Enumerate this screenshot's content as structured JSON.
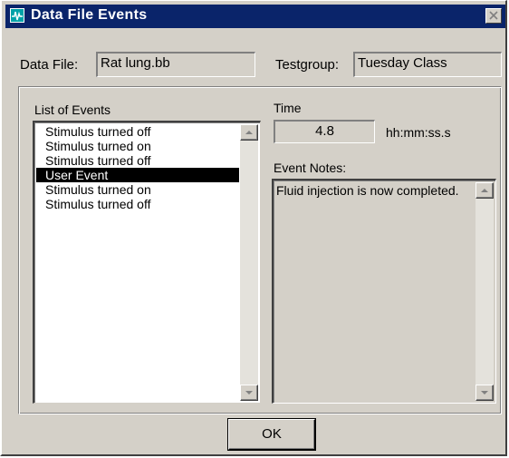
{
  "window": {
    "title": "Data File Events",
    "icon": "waveform-icon",
    "close_icon": "close-icon"
  },
  "header": {
    "data_file_label": "Data File:",
    "data_file_value": "Rat lung.bb",
    "testgroup_label": "Testgroup:",
    "testgroup_value": "Tuesday Class"
  },
  "events": {
    "label": "List of Events",
    "items": [
      "Stimulus turned off",
      "Stimulus turned on",
      "Stimulus turned off",
      "User Event",
      "Stimulus turned on",
      "Stimulus turned off"
    ],
    "selected": "User Event"
  },
  "time": {
    "label": "Time",
    "value": "4.8",
    "unit": "hh:mm:ss.s"
  },
  "notes": {
    "label": "Event Notes:",
    "text": "Fluid injection is now completed."
  },
  "footer": {
    "ok_label": "OK"
  },
  "colors": {
    "titlebar": "#0a246a",
    "dialog_face": "#d4d0c8",
    "selection": "#000000",
    "icon": "#00a2a8"
  }
}
